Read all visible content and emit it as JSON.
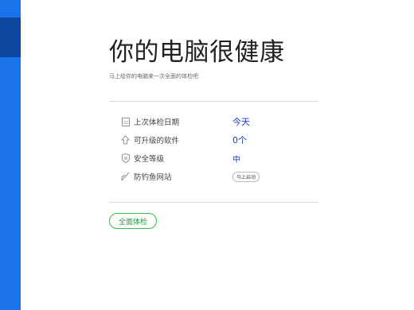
{
  "header": {
    "title": "你的电脑很健康",
    "subtitle": "马上给你的电脑来一次全面的体检吧"
  },
  "status_rows": [
    {
      "icon": "calendar-icon",
      "label": "上次体检日期",
      "value": "今天"
    },
    {
      "icon": "upgrade-icon",
      "label": "可升级的软件",
      "value": "0个"
    },
    {
      "icon": "shield-icon",
      "label": "安全等级",
      "value": "中"
    },
    {
      "icon": "phishing-icon",
      "label": "防钓鱼网站",
      "action": "马上启动"
    }
  ],
  "actions": {
    "full_scan_label": "全面体检"
  },
  "colors": {
    "sidebar": "#1a73e8",
    "sidebar_active": "#0d47a1",
    "value_text": "#1a3fbf",
    "scan_button": "#2fbf4a"
  }
}
